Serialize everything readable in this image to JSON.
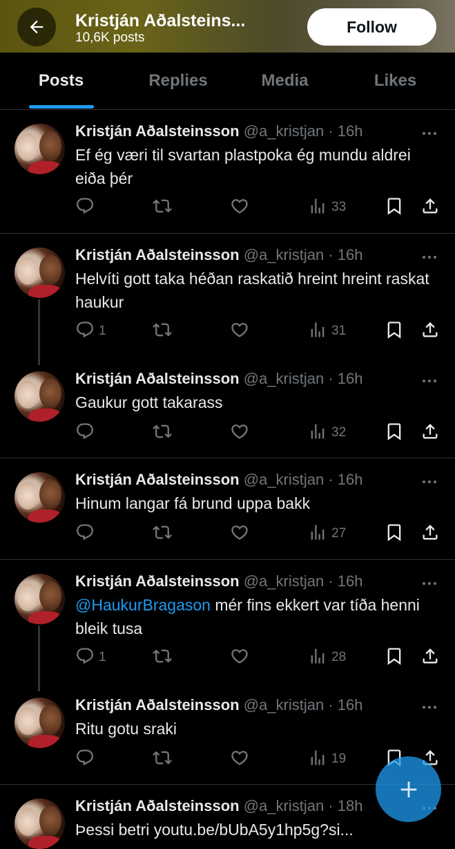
{
  "header": {
    "title": "Kristján Aðalsteins...",
    "post_count": "10,6K posts",
    "follow_label": "Follow"
  },
  "tabs": [
    {
      "label": "Posts",
      "active": true
    },
    {
      "label": "Replies",
      "active": false
    },
    {
      "label": "Media",
      "active": false
    },
    {
      "label": "Likes",
      "active": false
    }
  ],
  "colors": {
    "accent": "#1d9bf0",
    "background": "#000000",
    "muted": "#71767b",
    "divider": "#2f3336"
  },
  "posts": [
    {
      "name": "Kristján Aðalsteinsson",
      "handle": "@a_kristjan",
      "time": "16h",
      "mention": "",
      "text": "Ef ég væri til svartan plastpoka  ég mundu aldrei  eiða þér",
      "replies": "",
      "views": "33"
    },
    {
      "name": "Kristján Aðalsteinsson",
      "handle": "@a_kristjan",
      "time": "16h",
      "mention": "",
      "text": "Helvíti gott taka héðan raskatið hreint hreint raskat haukur",
      "replies": "1",
      "views": "31"
    },
    {
      "name": "Kristján Aðalsteinsson",
      "handle": "@a_kristjan",
      "time": "16h",
      "mention": "",
      "text": "Gaukur gott takarass",
      "replies": "",
      "views": "32"
    },
    {
      "name": "Kristján Aðalsteinsson",
      "handle": "@a_kristjan",
      "time": "16h",
      "mention": "",
      "text": "Hinum langar fá brund uppa bakk",
      "replies": "",
      "views": "27"
    },
    {
      "name": "Kristján Aðalsteinsson",
      "handle": "@a_kristjan",
      "time": "16h",
      "mention": "@HaukurBragason",
      "text": " mér fins ekkert var tíða henni bleik tusa",
      "replies": "1",
      "views": "28"
    },
    {
      "name": "Kristján Aðalsteinsson",
      "handle": "@a_kristjan",
      "time": "16h",
      "mention": "",
      "text": "Ritu gotu sraki",
      "replies": "",
      "views": "19"
    },
    {
      "name": "Kristján Aðalsteinsson",
      "handle": "@a_kristjan",
      "time": "18h",
      "mention": "",
      "text": "Þessi betri youtu.be/bUbA5y1hp5g?si...",
      "replies": "",
      "views": ""
    }
  ],
  "icons": {
    "back": "arrow-left-icon",
    "more": "more-dots-icon",
    "reply": "reply-bubble-icon",
    "repost": "repost-icon",
    "like": "heart-icon",
    "views": "views-bars-icon",
    "bookmark": "bookmark-icon",
    "share": "share-icon",
    "compose": "plus-icon"
  }
}
